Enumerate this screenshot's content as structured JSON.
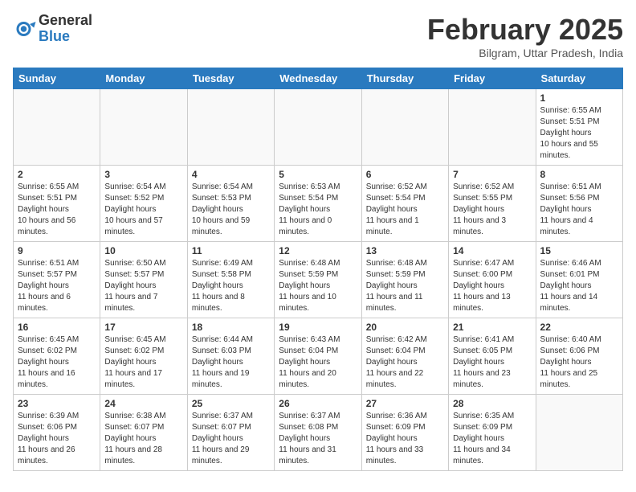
{
  "header": {
    "logo_general": "General",
    "logo_blue": "Blue",
    "month_title": "February 2025",
    "location": "Bilgram, Uttar Pradesh, India"
  },
  "days_of_week": [
    "Sunday",
    "Monday",
    "Tuesday",
    "Wednesday",
    "Thursday",
    "Friday",
    "Saturday"
  ],
  "weeks": [
    [
      {
        "day": "",
        "sunrise": "",
        "sunset": "",
        "daylight": ""
      },
      {
        "day": "",
        "sunrise": "",
        "sunset": "",
        "daylight": ""
      },
      {
        "day": "",
        "sunrise": "",
        "sunset": "",
        "daylight": ""
      },
      {
        "day": "",
        "sunrise": "",
        "sunset": "",
        "daylight": ""
      },
      {
        "day": "",
        "sunrise": "",
        "sunset": "",
        "daylight": ""
      },
      {
        "day": "",
        "sunrise": "",
        "sunset": "",
        "daylight": ""
      },
      {
        "day": "1",
        "sunrise": "6:55 AM",
        "sunset": "5:51 PM",
        "daylight": "10 hours and 55 minutes."
      }
    ],
    [
      {
        "day": "2",
        "sunrise": "6:55 AM",
        "sunset": "5:51 PM",
        "daylight": "10 hours and 56 minutes."
      },
      {
        "day": "3",
        "sunrise": "6:54 AM",
        "sunset": "5:52 PM",
        "daylight": "10 hours and 57 minutes."
      },
      {
        "day": "4",
        "sunrise": "6:54 AM",
        "sunset": "5:53 PM",
        "daylight": "10 hours and 59 minutes."
      },
      {
        "day": "5",
        "sunrise": "6:53 AM",
        "sunset": "5:54 PM",
        "daylight": "11 hours and 0 minutes."
      },
      {
        "day": "6",
        "sunrise": "6:52 AM",
        "sunset": "5:54 PM",
        "daylight": "11 hours and 1 minute."
      },
      {
        "day": "7",
        "sunrise": "6:52 AM",
        "sunset": "5:55 PM",
        "daylight": "11 hours and 3 minutes."
      },
      {
        "day": "8",
        "sunrise": "6:51 AM",
        "sunset": "5:56 PM",
        "daylight": "11 hours and 4 minutes."
      }
    ],
    [
      {
        "day": "9",
        "sunrise": "6:51 AM",
        "sunset": "5:57 PM",
        "daylight": "11 hours and 6 minutes."
      },
      {
        "day": "10",
        "sunrise": "6:50 AM",
        "sunset": "5:57 PM",
        "daylight": "11 hours and 7 minutes."
      },
      {
        "day": "11",
        "sunrise": "6:49 AM",
        "sunset": "5:58 PM",
        "daylight": "11 hours and 8 minutes."
      },
      {
        "day": "12",
        "sunrise": "6:48 AM",
        "sunset": "5:59 PM",
        "daylight": "11 hours and 10 minutes."
      },
      {
        "day": "13",
        "sunrise": "6:48 AM",
        "sunset": "5:59 PM",
        "daylight": "11 hours and 11 minutes."
      },
      {
        "day": "14",
        "sunrise": "6:47 AM",
        "sunset": "6:00 PM",
        "daylight": "11 hours and 13 minutes."
      },
      {
        "day": "15",
        "sunrise": "6:46 AM",
        "sunset": "6:01 PM",
        "daylight": "11 hours and 14 minutes."
      }
    ],
    [
      {
        "day": "16",
        "sunrise": "6:45 AM",
        "sunset": "6:02 PM",
        "daylight": "11 hours and 16 minutes."
      },
      {
        "day": "17",
        "sunrise": "6:45 AM",
        "sunset": "6:02 PM",
        "daylight": "11 hours and 17 minutes."
      },
      {
        "day": "18",
        "sunrise": "6:44 AM",
        "sunset": "6:03 PM",
        "daylight": "11 hours and 19 minutes."
      },
      {
        "day": "19",
        "sunrise": "6:43 AM",
        "sunset": "6:04 PM",
        "daylight": "11 hours and 20 minutes."
      },
      {
        "day": "20",
        "sunrise": "6:42 AM",
        "sunset": "6:04 PM",
        "daylight": "11 hours and 22 minutes."
      },
      {
        "day": "21",
        "sunrise": "6:41 AM",
        "sunset": "6:05 PM",
        "daylight": "11 hours and 23 minutes."
      },
      {
        "day": "22",
        "sunrise": "6:40 AM",
        "sunset": "6:06 PM",
        "daylight": "11 hours and 25 minutes."
      }
    ],
    [
      {
        "day": "23",
        "sunrise": "6:39 AM",
        "sunset": "6:06 PM",
        "daylight": "11 hours and 26 minutes."
      },
      {
        "day": "24",
        "sunrise": "6:38 AM",
        "sunset": "6:07 PM",
        "daylight": "11 hours and 28 minutes."
      },
      {
        "day": "25",
        "sunrise": "6:37 AM",
        "sunset": "6:07 PM",
        "daylight": "11 hours and 29 minutes."
      },
      {
        "day": "26",
        "sunrise": "6:37 AM",
        "sunset": "6:08 PM",
        "daylight": "11 hours and 31 minutes."
      },
      {
        "day": "27",
        "sunrise": "6:36 AM",
        "sunset": "6:09 PM",
        "daylight": "11 hours and 33 minutes."
      },
      {
        "day": "28",
        "sunrise": "6:35 AM",
        "sunset": "6:09 PM",
        "daylight": "11 hours and 34 minutes."
      },
      {
        "day": "",
        "sunrise": "",
        "sunset": "",
        "daylight": ""
      }
    ]
  ],
  "labels": {
    "sunrise": "Sunrise:",
    "sunset": "Sunset:",
    "daylight": "Daylight:"
  }
}
